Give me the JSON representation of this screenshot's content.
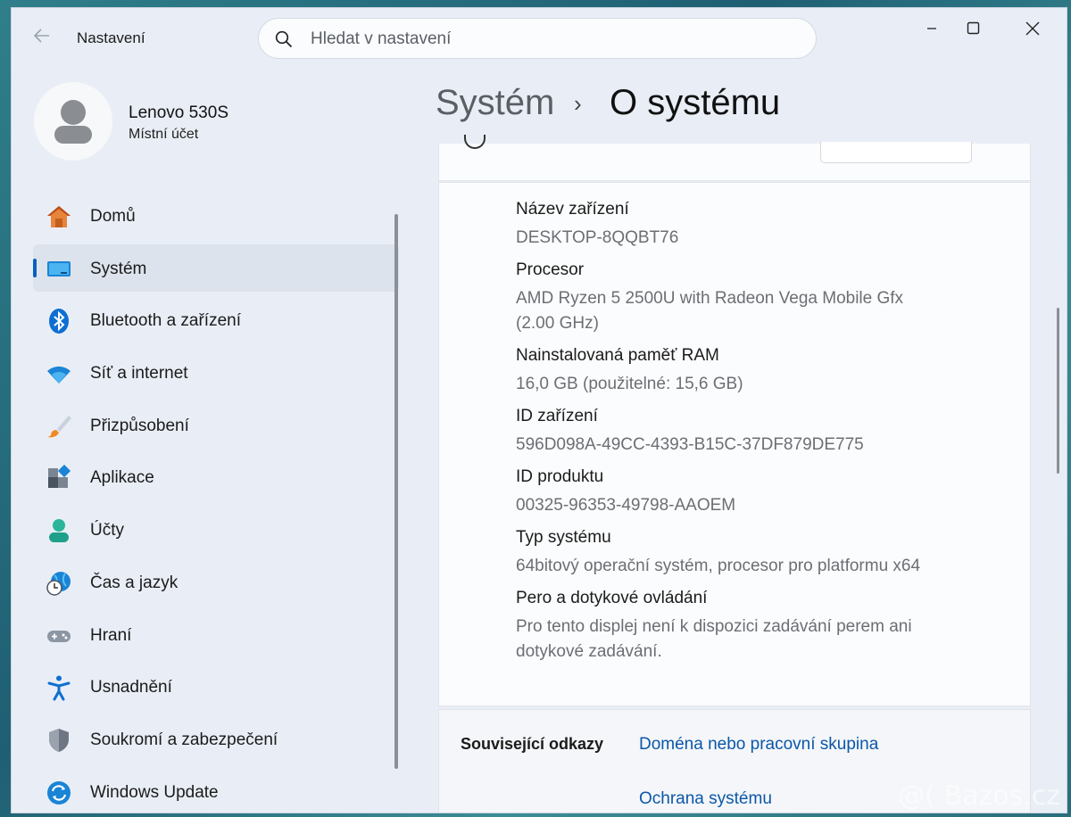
{
  "app": {
    "title": "Nastavení"
  },
  "search": {
    "placeholder": "Hledat v nastavení"
  },
  "profile": {
    "name": "Lenovo 530S",
    "account_type": "Místní účet"
  },
  "nav": {
    "items": [
      {
        "label": "Domů",
        "icon": "home-icon",
        "active": false
      },
      {
        "label": "Systém",
        "icon": "system-icon",
        "active": true
      },
      {
        "label": "Bluetooth a zařízení",
        "icon": "bluetooth-icon",
        "active": false
      },
      {
        "label": "Síť a internet",
        "icon": "wifi-icon",
        "active": false
      },
      {
        "label": "Přizpůsobení",
        "icon": "brush-icon",
        "active": false
      },
      {
        "label": "Aplikace",
        "icon": "apps-icon",
        "active": false
      },
      {
        "label": "Účty",
        "icon": "person-icon",
        "active": false
      },
      {
        "label": "Čas a jazyk",
        "icon": "globe-clock-icon",
        "active": false
      },
      {
        "label": "Hraní",
        "icon": "gamepad-icon",
        "active": false
      },
      {
        "label": "Usnadnění",
        "icon": "accessibility-icon",
        "active": false
      },
      {
        "label": "Soukromí a zabezpečení",
        "icon": "shield-icon",
        "active": false
      },
      {
        "label": "Windows Update",
        "icon": "update-icon",
        "active": false
      }
    ]
  },
  "breadcrumb": {
    "parent": "Systém",
    "separator": "›",
    "current": "O systému"
  },
  "specs": [
    {
      "label": "Název zařízení",
      "value": "DESKTOP-8QQBT76"
    },
    {
      "label": "Procesor",
      "value": "AMD Ryzen 5 2500U with Radeon Vega Mobile Gfx (2.00 GHz)"
    },
    {
      "label": "Nainstalovaná paměť RAM",
      "value": "16,0 GB (použitelné: 15,6 GB)"
    },
    {
      "label": "ID zařízení",
      "value": "596D098A-49CC-4393-B15C-37DF879DE775"
    },
    {
      "label": "ID produktu",
      "value": "00325-96353-49798-AAOEM"
    },
    {
      "label": "Typ systému",
      "value": "64bitový operační systém, procesor pro platformu x64"
    },
    {
      "label": "Pero a dotykové ovládání",
      "value": "Pro tento displej není k dispozici zadávání perem ani dotykové zadávání."
    }
  ],
  "related": {
    "title": "Související odkazy",
    "links": [
      "Doména nebo pracovní skupina",
      "Ochrana systému"
    ]
  },
  "watermark": "@( Bazos.cz",
  "colors": {
    "accent": "#0a5fbd",
    "link": "#0b57a8",
    "window_bg": "#e9eef6"
  }
}
